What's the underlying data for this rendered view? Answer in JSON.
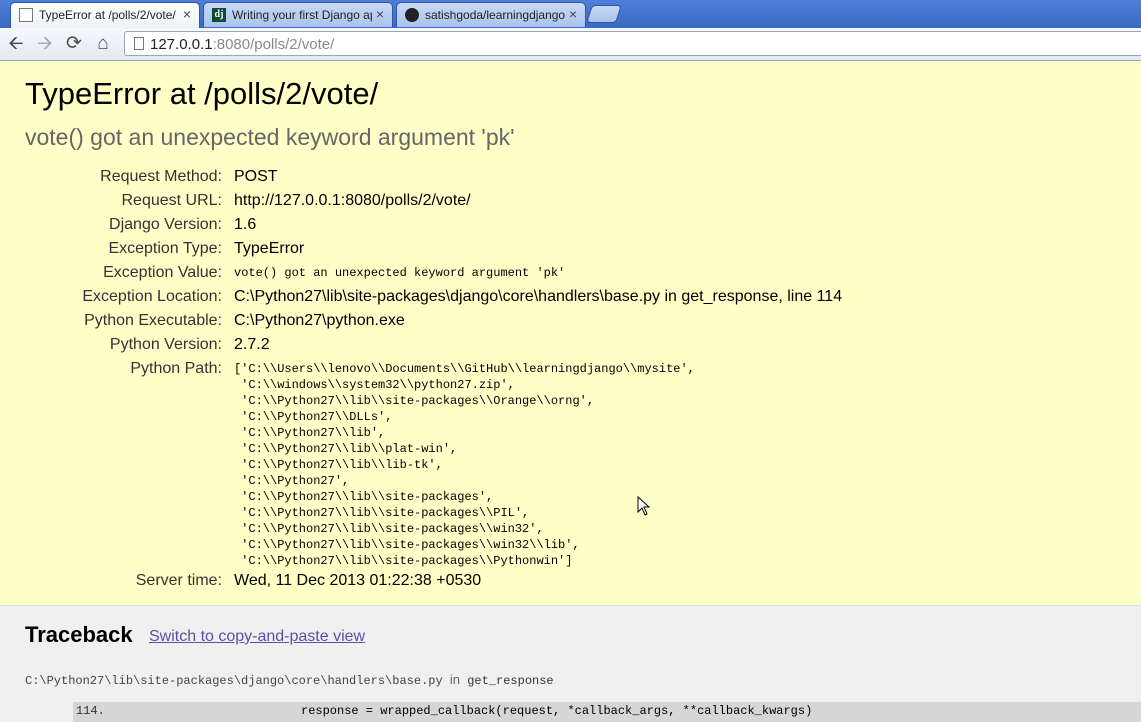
{
  "browser": {
    "tabs": [
      {
        "title": "TypeError at /polls/2/vote/",
        "close": "×"
      },
      {
        "title": "Writing your first Django app",
        "close": "×",
        "favicon_text": "dj"
      },
      {
        "title": "satishgoda/learningdjango",
        "close": "×"
      }
    ],
    "url": {
      "host": "127.0.0.1",
      "rest": ":8080/polls/2/vote/"
    }
  },
  "error": {
    "title": "TypeError at /polls/2/vote/",
    "message": "vote() got an unexpected keyword argument 'pk'"
  },
  "meta": [
    {
      "label": "Request Method:",
      "value": "POST"
    },
    {
      "label": "Request URL:",
      "value": "http://127.0.0.1:8080/polls/2/vote/"
    },
    {
      "label": "Django Version:",
      "value": "1.6"
    },
    {
      "label": "Exception Type:",
      "value": "TypeError"
    },
    {
      "label": "Exception Value:",
      "value": "vote() got an unexpected keyword argument 'pk'"
    },
    {
      "label": "Exception Location:",
      "value": "C:\\Python27\\lib\\site-packages\\django\\core\\handlers\\base.py in get_response, line 114"
    },
    {
      "label": "Python Executable:",
      "value": "C:\\Python27\\python.exe"
    },
    {
      "label": "Python Version:",
      "value": "2.7.2"
    },
    {
      "label": "Python Path:",
      "value": ""
    },
    {
      "label": "Server time:",
      "value": "Wed, 11 Dec 2013 01:22:38 +0530"
    }
  ],
  "python_path": "['C:\\\\Users\\\\lenovo\\\\Documents\\\\GitHub\\\\learningdjango\\\\mysite',\n 'C:\\\\windows\\\\system32\\\\python27.zip',\n 'C:\\\\Python27\\\\lib\\\\site-packages\\\\Orange\\\\orng',\n 'C:\\\\Python27\\\\DLLs',\n 'C:\\\\Python27\\\\lib',\n 'C:\\\\Python27\\\\lib\\\\plat-win',\n 'C:\\\\Python27\\\\lib\\\\lib-tk',\n 'C:\\\\Python27',\n 'C:\\\\Python27\\\\lib\\\\site-packages',\n 'C:\\\\Python27\\\\lib\\\\site-packages\\\\PIL',\n 'C:\\\\Python27\\\\lib\\\\site-packages\\\\win32',\n 'C:\\\\Python27\\\\lib\\\\site-packages\\\\win32\\\\lib',\n 'C:\\\\Python27\\\\lib\\\\site-packages\\\\Pythonwin']",
  "traceback": {
    "heading": "Traceback",
    "switch_link": "Switch to copy-and-paste view",
    "frame": {
      "file": "C:\\Python27\\lib\\site-packages\\django\\core\\handlers\\base.py",
      "in_word": "in",
      "function": "get_response",
      "line_number": "114.",
      "code": "response = wrapped_callback(request, *callback_args, **callback_kwargs)"
    }
  }
}
